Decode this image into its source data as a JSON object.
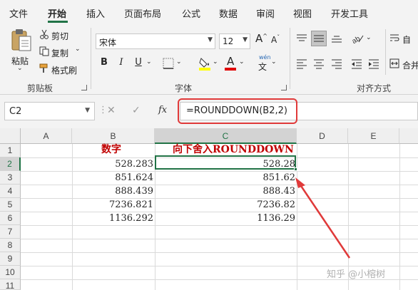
{
  "menu": {
    "tabs": [
      "文件",
      "开始",
      "插入",
      "页面布局",
      "公式",
      "数据",
      "审阅",
      "视图",
      "开发工具"
    ],
    "active_tab": "开始"
  },
  "ribbon": {
    "clipboard": {
      "paste_label": "粘贴",
      "cut_label": "剪切",
      "copy_label": "复制",
      "format_painter_label": "格式刷",
      "group_label": "剪贴板"
    },
    "font": {
      "font_name": "宋体",
      "font_size": "12",
      "bold": "B",
      "italic": "I",
      "underline": "U",
      "phonetic_top": "wén",
      "phonetic_bottom": "文",
      "font_color_glyph": "A",
      "group_label": "字体"
    },
    "alignment": {
      "wrap_label": "自",
      "merge_label": "合并",
      "group_label": "对齐方式"
    }
  },
  "formula_bar": {
    "name_box": "C2",
    "cancel_glyph": "✕",
    "confirm_glyph": "✓",
    "fx_label": "fx",
    "formula": "=ROUNDDOWN(B2,2)"
  },
  "sheet": {
    "columns": [
      "A",
      "B",
      "C",
      "D",
      "E"
    ],
    "rows": [
      "1",
      "2",
      "3",
      "4",
      "5",
      "6",
      "7",
      "8",
      "9",
      "10",
      "11"
    ],
    "selected_column": "C",
    "selected_row": "2",
    "header_b": "数字",
    "header_c": "向下舍入ROUNDDOWN",
    "b_values": [
      "528.283",
      "851.624",
      "888.439",
      "7236.821",
      "1136.292"
    ],
    "c_values": [
      "528.28",
      "851.62",
      "888.43",
      "7236.82",
      "1136.29"
    ]
  },
  "watermark": "知乎 @小榕树",
  "colors": {
    "accent_green": "#217346",
    "annotation_red": "#e03a3a",
    "header_text_red": "#c00000"
  }
}
